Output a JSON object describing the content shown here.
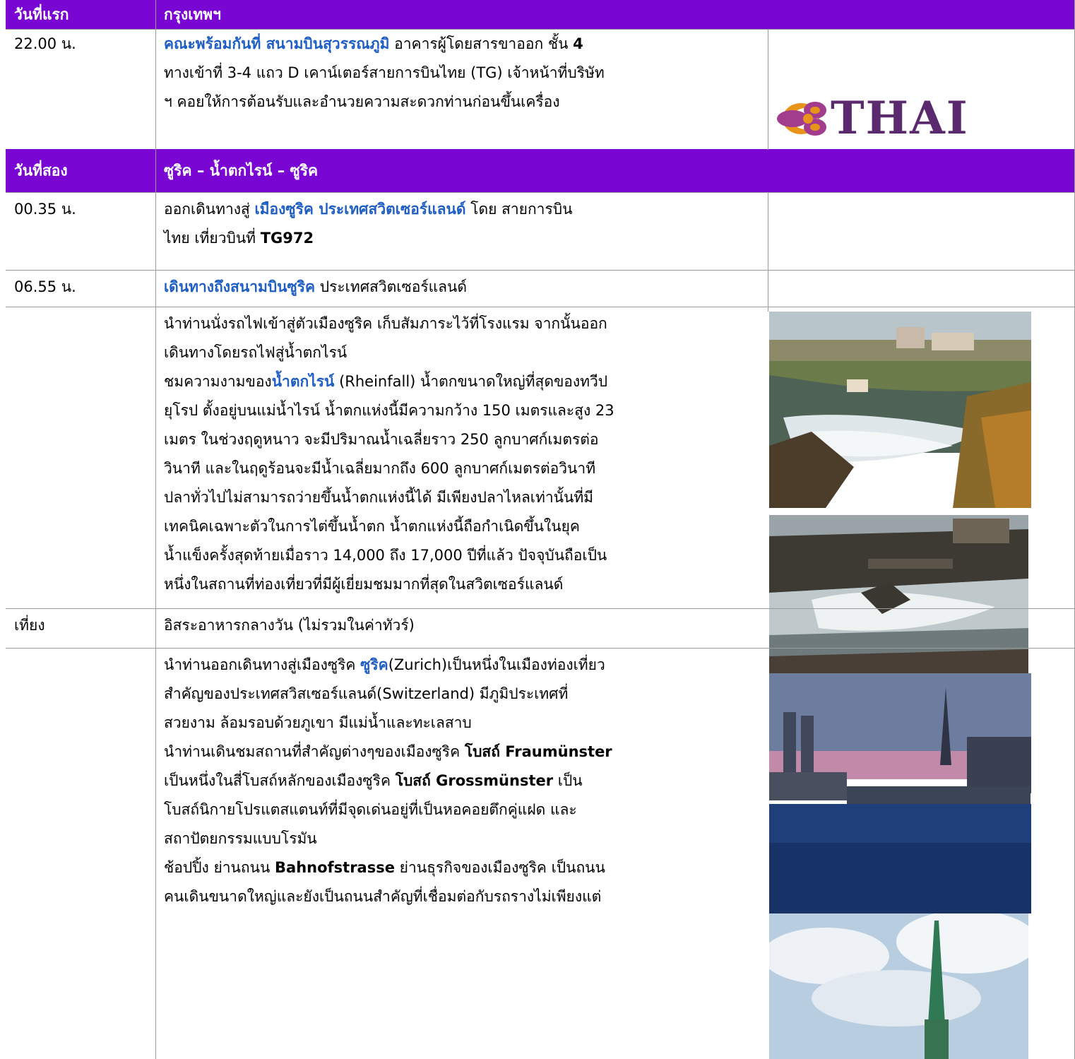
{
  "day1": {
    "label": "วันที่แรก",
    "title": "กรุงเทพฯ",
    "time": "22.00 น.",
    "line1": {
      "hl": "คณะพร้อมกันที่ สนามบินสุวรรณภูมิ",
      "text": " อาคารผู้โดยสารขาออก ชั้น ",
      "bold": "4"
    },
    "line2": "ทางเข้าที่ 3-4 แถว D  เคาน์เตอร์สายการบินไทย (TG) เจ้าหน้าที่บริษัท",
    "line3": "ฯ คอยให้การต้อนรับและอำนวยความสะดวกท่านก่อนขึ้นเครื่อง",
    "logo_text": "THAI"
  },
  "day2": {
    "label": "วันที่สอง",
    "title": "ซูริค – น้ำตกไรน์ – ซูริค",
    "row1": {
      "time": "00.35 น.",
      "a": "ออกเดินทางสู่ ",
      "hl": "เมืองซูริค ประเทศสวิตเซอร์แลนด์",
      "b": " โดย สายการบิน",
      "line2a": "ไทย เที่ยวบินที่ ",
      "line2b": "TG972"
    },
    "row2": {
      "time": "06.55 น.",
      "hl": "เดินทางถึงสนามบินซูริค",
      "text": " ประเทศสวิตเซอร์แลนด์"
    },
    "rhein": {
      "l1": "นำท่านนั่งรถไฟเข้าสู่ตัวเมืองซูริค เก็บสัมภาระไว้ที่โรงแรม จากนั้นออก",
      "l2": "เดินทางโดยรถไฟสู่น้ำตกไรน์",
      "l3a": "ชมความงามของ",
      "l3hl": "น้ำตกไรน์",
      "l3b": " (Rheinfall) น้ำตกขนาดใหญ่ที่สุดของทวีป",
      "l4": "ยุโรป ตั้งอยู่บนแม่น้ำไรน์ น้ำตกแห่งนี้มีความกว้าง 150 เมตรและสูง 23",
      "l5": "เมตร ในช่วงฤดูหนาว จะมีปริมาณน้ำเฉลี่ยราว 250 ลูกบาศก์เมตรต่อ",
      "l6": "วินาที และในฤดูร้อนจะมีน้ำเฉลี่ยมากถึง 600 ลูกบาศก์เมตรต่อวินาที",
      "l7": "ปลาทั่วไปไม่สามารถว่ายขึ้นน้ำตกแห่งนี้ได้ มีเพียงปลาไหลเท่านั้นที่มี",
      "l8": "เทคนิคเฉพาะตัวในการไต่ขึ้นน้ำตก น้ำตกแห่งนี้ถือกำเนิดขึ้นในยุค",
      "l9": "น้ำแข็งครั้งสุดท้ายเมื่อราว 14,000 ถึง 17,000 ปีที่แล้ว ปัจจุบันถือเป็น",
      "l10": "หนึ่งในสถานที่ท่องเที่ยวที่มีผู้เยี่ยมชมมากที่สุดในสวิตเซอร์แลนด์"
    },
    "lunch": {
      "time": "เที่ยง",
      "text": "อิสระอาหารกลางวัน (ไม่รวมในค่าทัวร์)"
    },
    "zurich": {
      "l1a": "นำท่านออกเดินทางสู่เมืองซูริค ",
      "l1hl": "ซูริค",
      "l1b": "(Zurich)เป็นหนึ่งในเมืองท่องเที่ยว",
      "l2": "สำคัญของประเทศสวิสเซอร์แลนด์(Switzerland) มีภูมิประเทศที่",
      "l3": "สวยงาม ล้อมรอบด้วยภูเขา มีแม่น้ำและทะเลสาบ",
      "l4a": "นำท่านเดินชมสถานที่สำคัญต่างๆของเมืองซูริค ",
      "l4b": "โบสถ์ Fraumünster",
      "l5a": "เป็นหนึ่งในสี่โบสถ์หลักของเมืองซูริค ",
      "l5b": "โบสถ์ Grossmünster",
      "l5c": " เป็น",
      "l6": "โบสถ์นิกายโปรแตสแตนท์ที่มีจุดเด่นอยู่ที่เป็นหอคอยตึกคู่แฝด และ",
      "l7": "สถาปัตยกรรมแบบโรมัน",
      "l8a": "ช้อปปิ้ง ย่านถนน ",
      "l8b": "Bahnofstrasse",
      "l8c": " ย่านธุรกิจของเมืองซูริค เป็นถนน",
      "l9": "คนเดินขนาดใหญ่และยังเป็นถนนสำคัญที่เชื่อมต่อกับรถรางไม่เพียงแต่"
    }
  },
  "colors": {
    "header_bg": "#7a06d4",
    "highlight": "#1f5fc4",
    "logo_purple": "#5b2a6e",
    "logo_orange": "#e8941a"
  }
}
